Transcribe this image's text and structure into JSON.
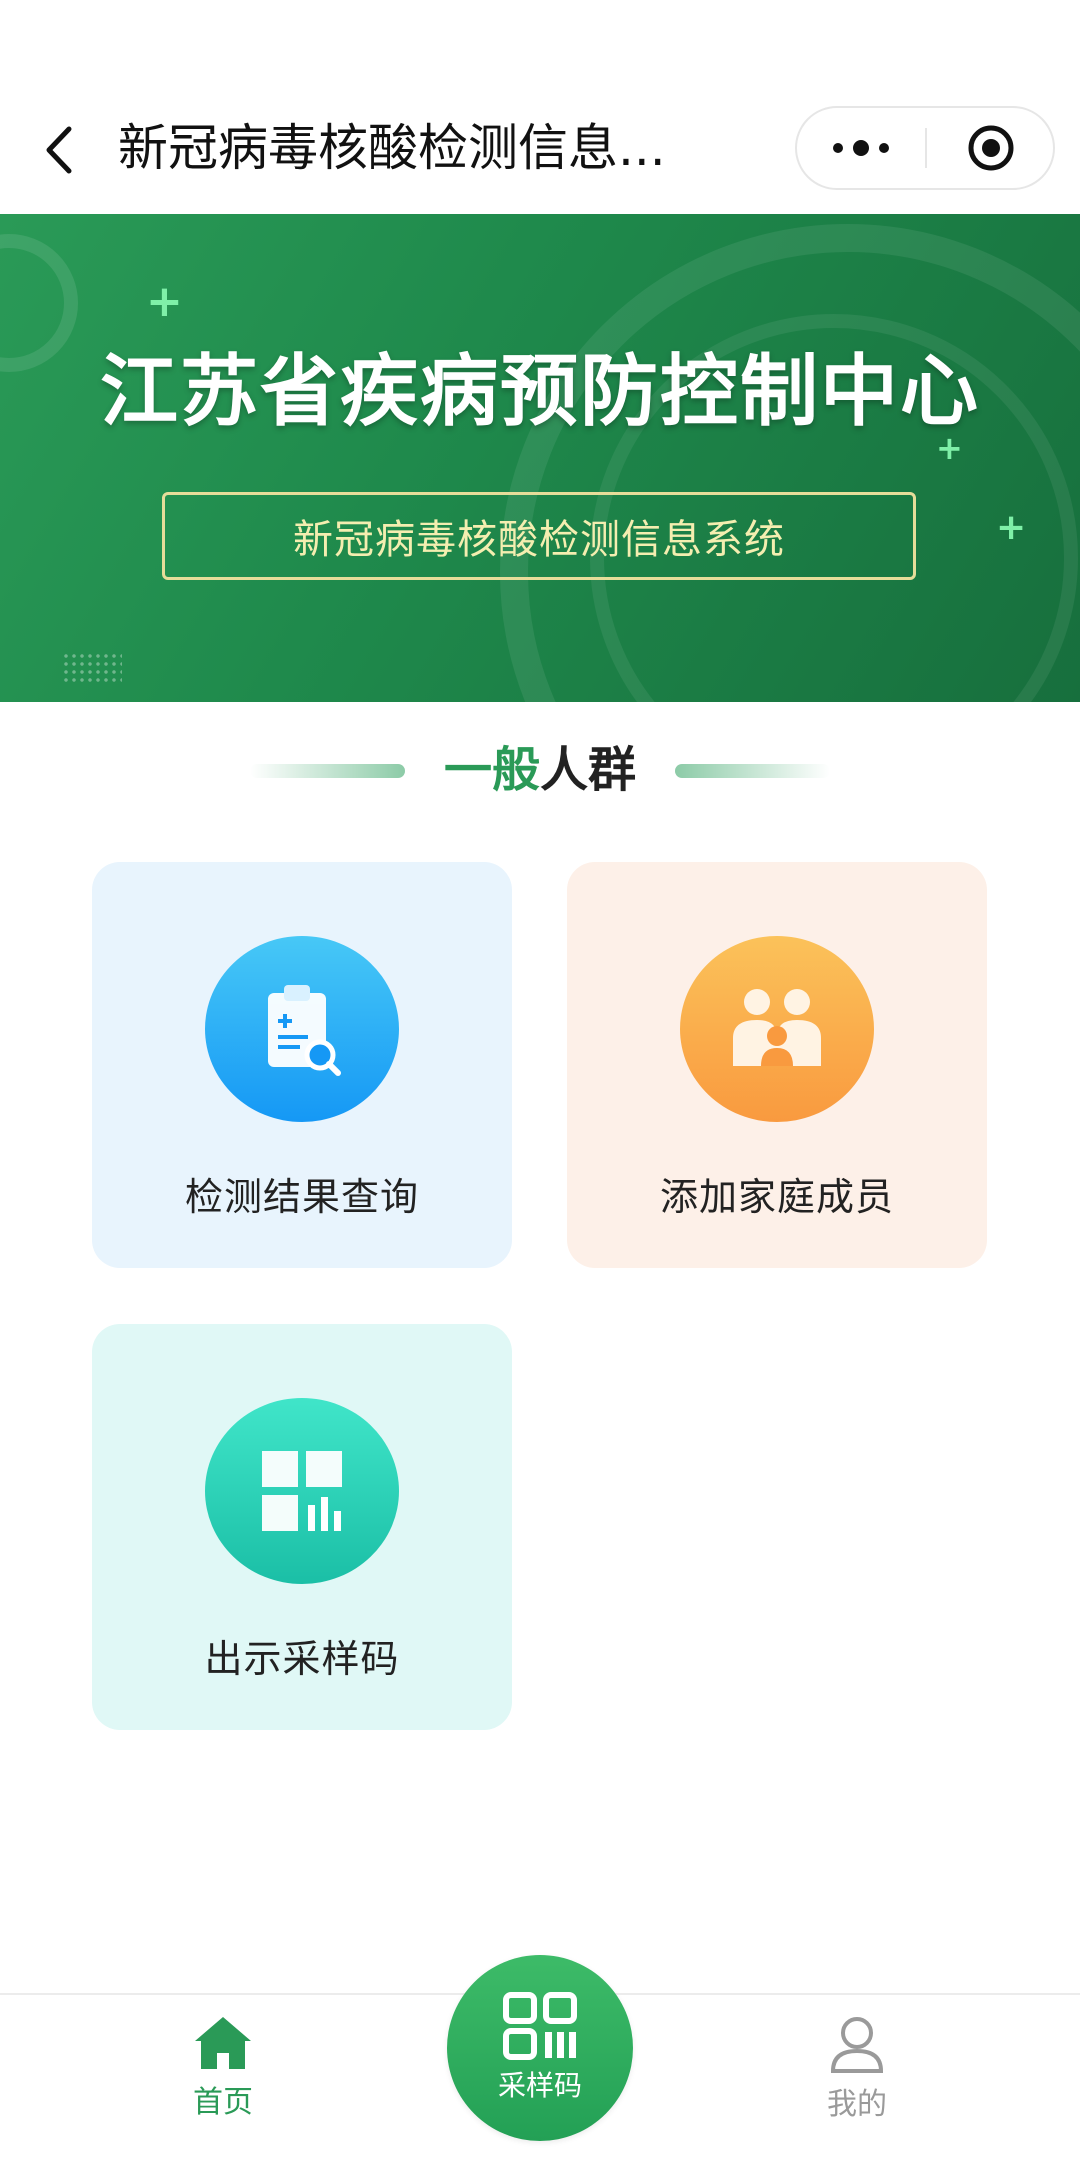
{
  "navbar": {
    "title": "新冠病毒核酸检测信息..."
  },
  "banner": {
    "title": "江苏省疾病预防控制中心",
    "subtitle": "新冠病毒核酸检测信息系统"
  },
  "section": {
    "title_accent": "一般",
    "title_rest": "人群"
  },
  "cards": [
    {
      "label": "检测结果查询",
      "icon": "clipboard-search-icon"
    },
    {
      "label": "添加家庭成员",
      "icon": "family-icon"
    },
    {
      "label": "出示采样码",
      "icon": "grid-chart-icon"
    }
  ],
  "tabbar": {
    "home_label": "首页",
    "center_label": "采样码",
    "mine_label": "我的"
  },
  "colors": {
    "brand_green": "#2a9a57",
    "query_card_bg": "#e8f4fd",
    "family_card_bg": "#fdf0e8",
    "code_card_bg": "#e0f8f6"
  }
}
